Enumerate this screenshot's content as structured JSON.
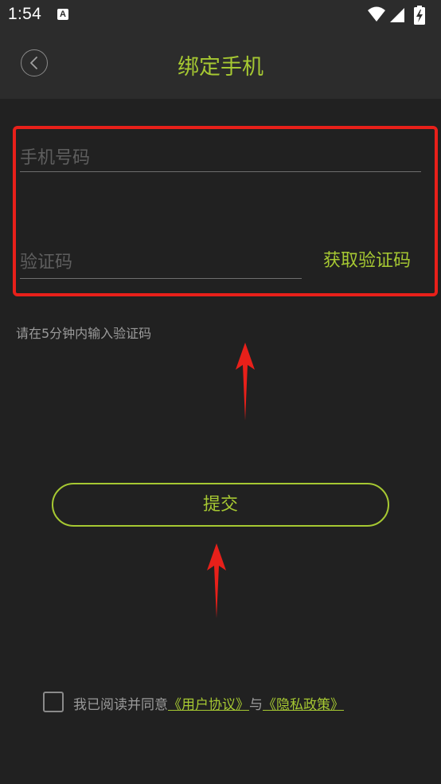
{
  "status_bar": {
    "time": "1:54",
    "app_icon_letter": "A",
    "icons": [
      "wifi-icon",
      "signal-icon",
      "battery-charging-icon"
    ]
  },
  "header": {
    "title": "绑定手机"
  },
  "form": {
    "phone_placeholder": "手机号码",
    "code_placeholder": "验证码",
    "get_code_label": "获取验证码"
  },
  "hint": "请在5分钟内输入验证码",
  "submit_label": "提交",
  "agreement": {
    "prefix": "我已阅读并同意",
    "user_agreement": "《用户协议》",
    "conjunction": "与",
    "privacy_policy": "《隐私政策》"
  },
  "colors": {
    "accent": "#a6c832",
    "background": "#212121",
    "header_bg": "#2c2c2c",
    "highlight_border": "#e8201a",
    "annotation_arrow": "#e8201a"
  }
}
